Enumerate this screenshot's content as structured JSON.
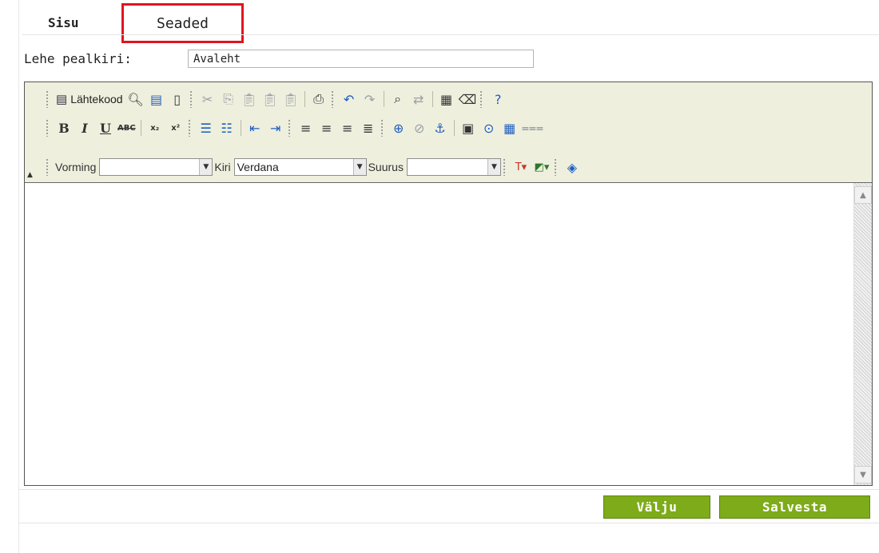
{
  "tabs": {
    "content": "Sisu",
    "settings": "Seaded"
  },
  "page_title": {
    "label": "Lehe pealkiri:",
    "value": "Avaleht"
  },
  "toolbar": {
    "source_label": "Lähtekood",
    "format_label": "Vorming",
    "format_value": "",
    "font_label": "Kiri",
    "font_value": "Verdana",
    "size_label": "Suurus",
    "size_value": ""
  },
  "icons": {
    "preview": "🔍︎",
    "templates": "▤",
    "new_page": "▯",
    "cut": "✂",
    "copy": "⎘",
    "paste": "📋︎",
    "paste_text": "📋︎",
    "paste_word": "📋︎",
    "print": "⎙",
    "undo": "↶",
    "redo": "↷",
    "find": "⌕",
    "replace": "⇄",
    "select_all": "▦",
    "remove_format": "⌫",
    "help": "?",
    "bold": "B",
    "italic": "I",
    "underline": "U",
    "strike": "ABC",
    "subscript": "x₂",
    "superscript": "x²",
    "ordered_list": "☰",
    "unordered_list": "☷",
    "outdent": "⇤",
    "indent": "⇥",
    "align_left": "≡",
    "align_center": "≡",
    "align_right": "≡",
    "justify": "≣",
    "link": "⊕",
    "unlink": "⊘",
    "anchor": "⚓︎",
    "image": "▣",
    "flash": "⊙",
    "table": "▦",
    "horizontal_rule": "⩶",
    "text_color": "T▾",
    "bg_color": "◩▾",
    "about": "◈",
    "collapse": "▲",
    "dropdown_arrow": "▼",
    "scroll_up": "▲",
    "scroll_down": "▼"
  },
  "colors": {
    "accent_button": "#7eab1a",
    "highlight_border": "#e0141e",
    "toolbar_bg": "#efefde"
  },
  "actions": {
    "exit": "Välju",
    "save": "Salvesta"
  }
}
